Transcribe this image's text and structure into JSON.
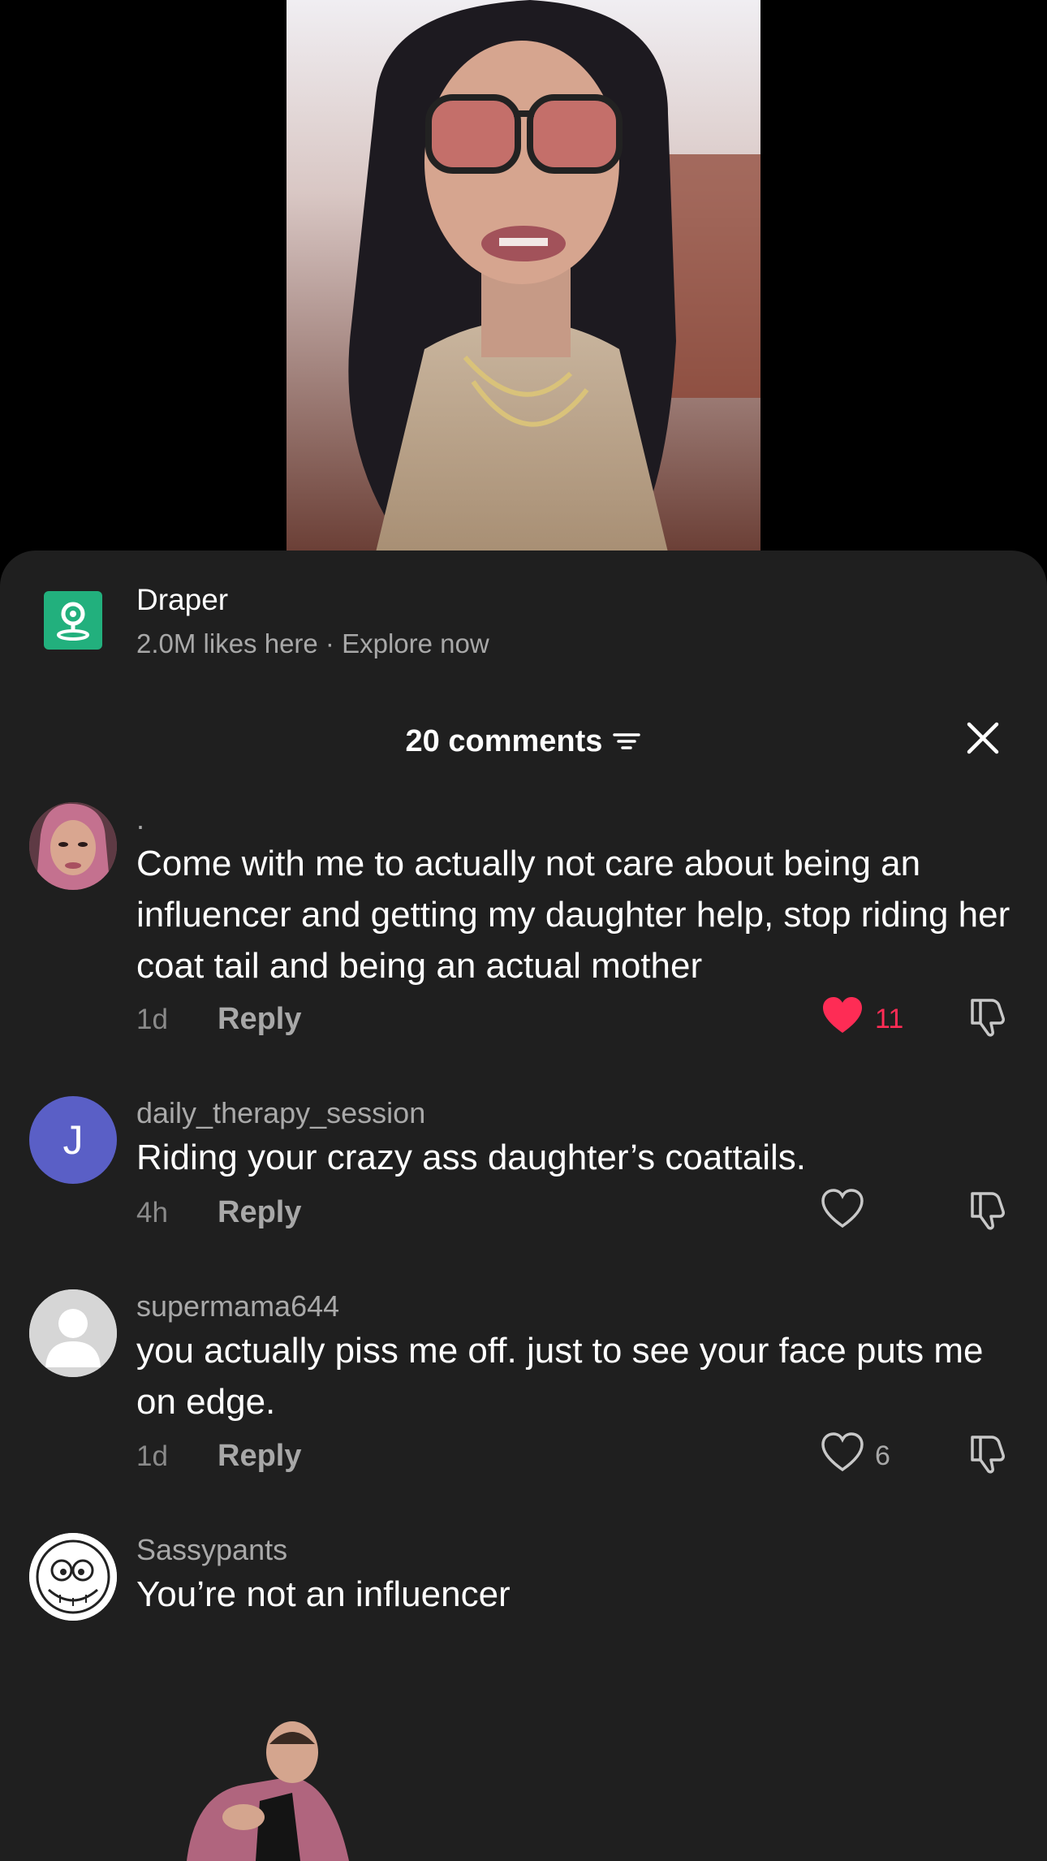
{
  "place": {
    "title": "Draper",
    "likes": "2.0M likes here",
    "separator": " · ",
    "explore": "Explore now"
  },
  "header": {
    "count": "20 comments"
  },
  "comments": [
    {
      "username": ".",
      "text": "Come with me to actually not care about being an influencer and getting my daughter help, stop riding her coat tail and being an actual mother",
      "time": "1d",
      "reply": "Reply",
      "likes": "11",
      "liked": true
    },
    {
      "username": "daily_therapy_session",
      "avatar_letter": "J",
      "text": "Riding your crazy ass daughter’s coattails.",
      "time": "4h",
      "reply": "Reply",
      "likes": "",
      "liked": false
    },
    {
      "username": "supermama644",
      "text": "you actually piss me off. just to see your face puts me on edge.",
      "time": "1d",
      "reply": "Reply",
      "likes": "6",
      "liked": false
    },
    {
      "username": "Sassypants",
      "text": "You’re not an influencer"
    }
  ],
  "colors": {
    "sheet_bg": "#1f1f1f",
    "liked_heart": "#fe2c55",
    "place_icon": "#22b07d",
    "avatar_j": "#5a5fc6"
  },
  "icons": [
    "location-pin-icon",
    "sort-icon",
    "close-icon",
    "heart-icon",
    "dislike-icon"
  ]
}
